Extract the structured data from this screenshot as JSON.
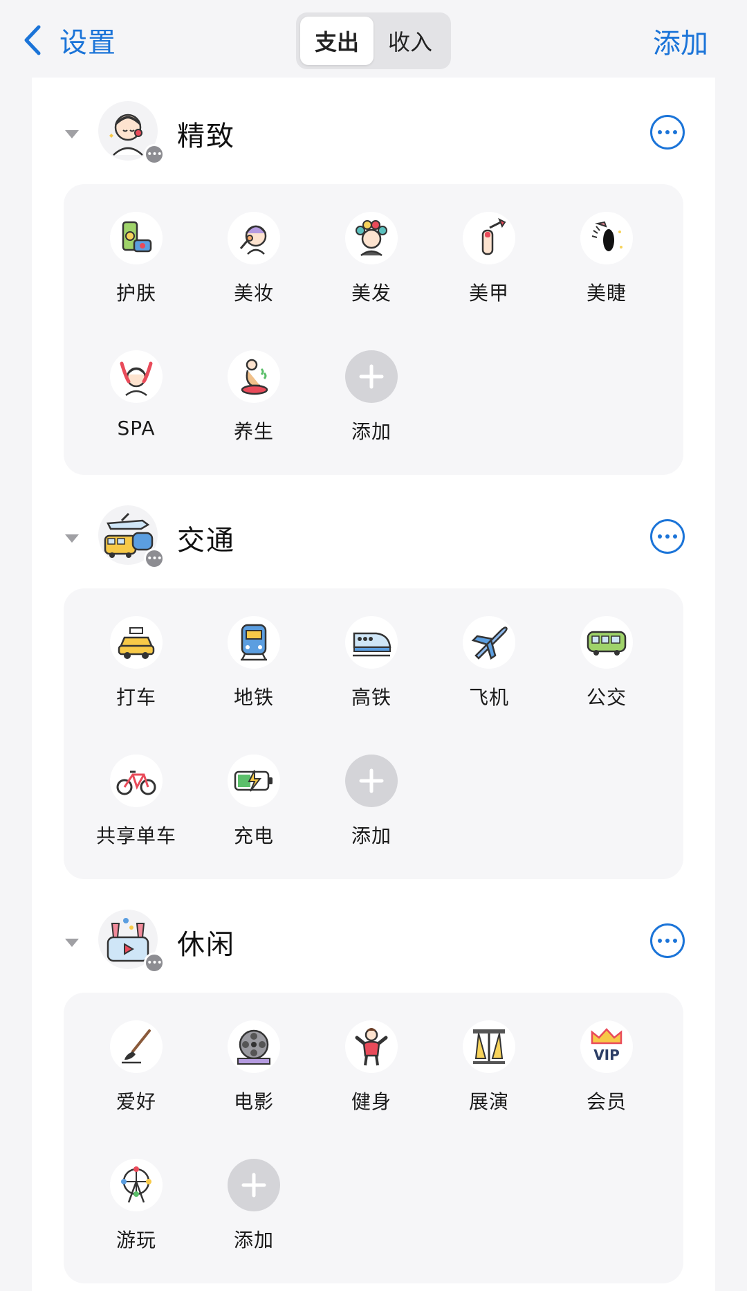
{
  "header": {
    "back_label": "设置",
    "tabs": [
      {
        "label": "支出",
        "active": true
      },
      {
        "label": "收入",
        "active": false
      }
    ],
    "add_label": "添加"
  },
  "colors": {
    "accent": "#1b74d8",
    "background": "#f5f5f7",
    "card": "#f6f6f8"
  },
  "categories": [
    {
      "title": "精致",
      "icon": "beauty-face-icon",
      "items": [
        {
          "label": "护肤",
          "icon": "skincare-icon"
        },
        {
          "label": "美妆",
          "icon": "makeup-icon"
        },
        {
          "label": "美发",
          "icon": "hair-curlers-icon"
        },
        {
          "label": "美甲",
          "icon": "nail-polish-icon"
        },
        {
          "label": "美睫",
          "icon": "eyelash-icon"
        },
        {
          "label": "SPA",
          "icon": "spa-icon"
        },
        {
          "label": "养生",
          "icon": "wellness-icon"
        },
        {
          "label": "添加",
          "icon": "plus-icon"
        }
      ]
    },
    {
      "title": "交通",
      "icon": "transport-icon",
      "items": [
        {
          "label": "打车",
          "icon": "taxi-icon"
        },
        {
          "label": "地铁",
          "icon": "metro-icon"
        },
        {
          "label": "高铁",
          "icon": "high-speed-train-icon"
        },
        {
          "label": "飞机",
          "icon": "airplane-icon"
        },
        {
          "label": "公交",
          "icon": "bus-icon"
        },
        {
          "label": "共享单车",
          "icon": "bicycle-icon"
        },
        {
          "label": "充电",
          "icon": "battery-charging-icon"
        },
        {
          "label": "添加",
          "icon": "plus-icon"
        }
      ]
    },
    {
      "title": "休闲",
      "icon": "leisure-icon",
      "items": [
        {
          "label": "爱好",
          "icon": "paintbrush-icon"
        },
        {
          "label": "电影",
          "icon": "film-reel-icon"
        },
        {
          "label": "健身",
          "icon": "fitness-icon"
        },
        {
          "label": "展演",
          "icon": "stage-lights-icon"
        },
        {
          "label": "会员",
          "icon": "vip-crown-icon"
        },
        {
          "label": "游玩",
          "icon": "ferris-wheel-icon"
        },
        {
          "label": "添加",
          "icon": "plus-icon"
        }
      ]
    }
  ]
}
